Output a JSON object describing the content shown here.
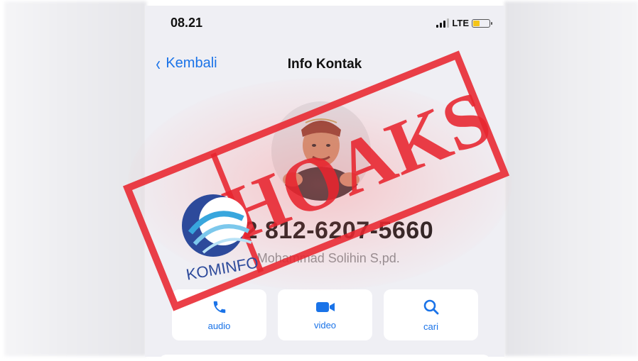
{
  "status_bar": {
    "time": "08.21",
    "network": "LTE"
  },
  "nav": {
    "back_label": "Kembali",
    "title": "Info Kontak"
  },
  "contact": {
    "number": "+62 812-6207-5660",
    "name": "~Mohammad Solihin S,pd."
  },
  "actions": [
    {
      "label": "audio",
      "icon": "phone-icon"
    },
    {
      "label": "video",
      "icon": "video-camera-icon"
    },
    {
      "label": "cari",
      "icon": "search-icon"
    }
  ],
  "overlay": {
    "stamp_text": "HOAKS",
    "logo_text": "KOMINFO",
    "stamp_color": "#e8252f"
  },
  "colors": {
    "accent": "#1a73e8",
    "battery": "#f5c518",
    "background": "#efeff4"
  }
}
